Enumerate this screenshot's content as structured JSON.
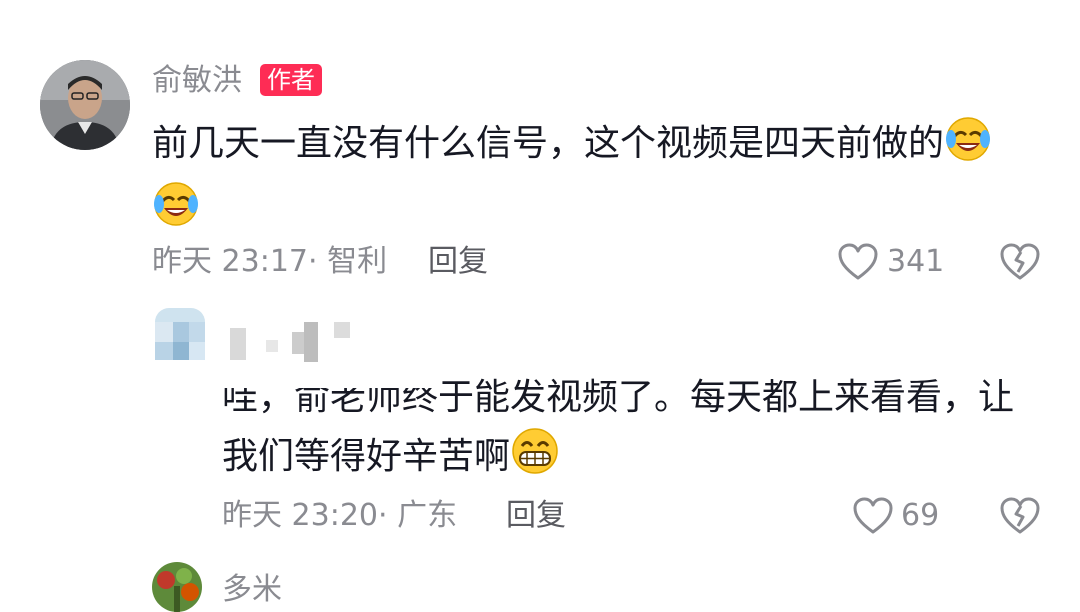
{
  "comment1": {
    "author": "俞敏洪",
    "badge": "作者",
    "text": "前几天一直没有什么信号，这个视频是四天前做的",
    "emojis": [
      "laugh-cry-emoji",
      "laugh-cry-emoji"
    ],
    "time": "昨天 23:17",
    "location": "· 智利",
    "reply_label": "回复",
    "likes": "341"
  },
  "comment2": {
    "author_blurred": true,
    "text_line1": "哇，俞老师终于能发视频了。每天都上来看看，让",
    "text_line2": "我们等得好辛苦啊",
    "emoji": "grin-emoji",
    "time": "昨天 23:20",
    "location": "· 广东",
    "reply_label": "回复",
    "likes": "69"
  },
  "comment3": {
    "author": "多米"
  },
  "colors": {
    "badge": "#fe2c55",
    "meta": "#8a8b91",
    "text": "#161823"
  }
}
